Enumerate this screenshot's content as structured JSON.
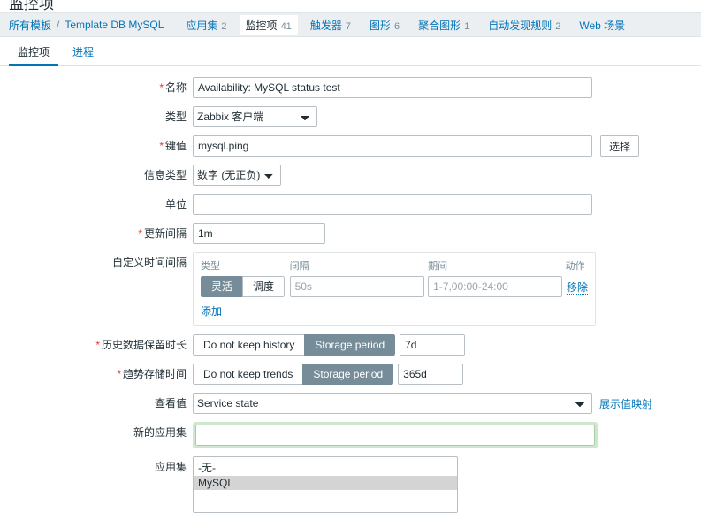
{
  "page": {
    "title": "监控项"
  },
  "breadcrumb": {
    "all_templates": "所有模板",
    "separator": "/",
    "template_name": "Template DB MySQL"
  },
  "object_nav": [
    {
      "label": "应用集",
      "count": "2",
      "active": false
    },
    {
      "label": "监控项",
      "count": "41",
      "active": true
    },
    {
      "label": "触发器",
      "count": "7",
      "active": false
    },
    {
      "label": "图形",
      "count": "6",
      "active": false
    },
    {
      "label": "聚合图形",
      "count": "1",
      "active": false
    },
    {
      "label": "自动发现规则",
      "count": "2",
      "active": false
    },
    {
      "label": "Web 场景",
      "count": "",
      "active": false
    }
  ],
  "tabs": [
    {
      "label": "监控项",
      "active": true
    },
    {
      "label": "进程",
      "active": false
    }
  ],
  "form": {
    "name": {
      "label": "名称",
      "required": true,
      "value": "Availability: MySQL status test"
    },
    "type": {
      "label": "类型",
      "required": false,
      "value": "Zabbix 客户端"
    },
    "key": {
      "label": "键值",
      "required": true,
      "value": "mysql.ping",
      "select_button": "选择"
    },
    "info_type": {
      "label": "信息类型",
      "required": false,
      "value": "数字 (无正负)"
    },
    "units": {
      "label": "单位",
      "required": false,
      "value": ""
    },
    "update_interval": {
      "label": "更新间隔",
      "required": false,
      "value": "1m"
    },
    "custom_intervals": {
      "label": "自定义时间间隔",
      "headers": {
        "type": "类型",
        "interval": "间隔",
        "period": "期间",
        "action": "动作"
      },
      "rows": [
        {
          "type_flexible": "灵活",
          "type_scheduling": "调度",
          "type_selected": "灵活",
          "interval_placeholder": "50s",
          "interval_value": "",
          "period_placeholder": "1-7,00:00-24:00",
          "period_value": "",
          "remove_label": "移除"
        }
      ],
      "add_label": "添加"
    },
    "history": {
      "label": "历史数据保留时长",
      "required": true,
      "option_off": "Do not keep history",
      "option_on": "Storage period",
      "selected": "Storage period",
      "value": "7d"
    },
    "trends": {
      "label": "趋势存储时间",
      "required": true,
      "option_off": "Do not keep trends",
      "option_on": "Storage period",
      "selected": "Storage period",
      "value": "365d"
    },
    "show_value": {
      "label": "查看值",
      "required": false,
      "value": "Service state",
      "link_label": "展示值映射"
    },
    "new_application": {
      "label": "新的应用集",
      "required": false,
      "value": "",
      "focused": true
    },
    "applications": {
      "label": "应用集",
      "required": false,
      "options": [
        {
          "label": "-无-",
          "selected": false
        },
        {
          "label": "MySQL",
          "selected": true
        }
      ]
    }
  }
}
